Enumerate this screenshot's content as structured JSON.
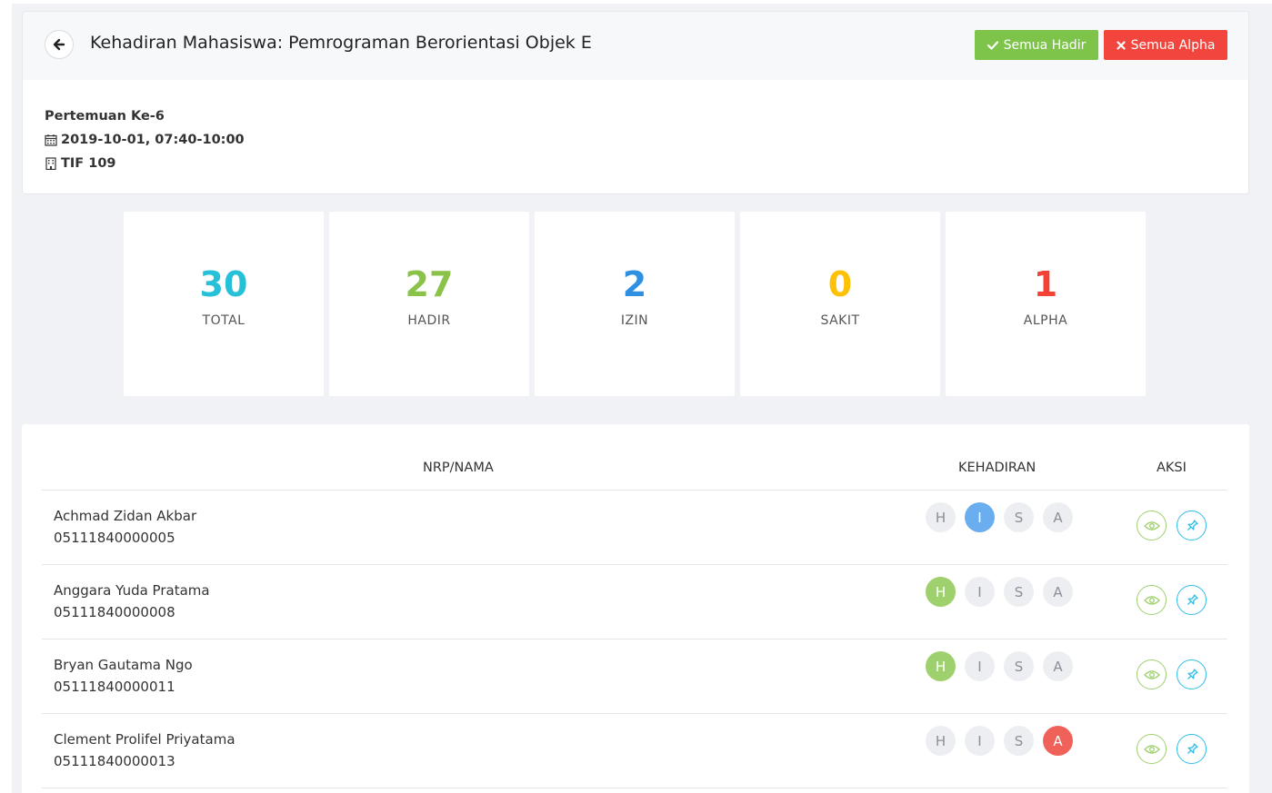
{
  "header": {
    "title": "Kehadiran Mahasiswa: Pemrograman Berorientasi Objek E",
    "btn_all_present": "Semua Hadir",
    "btn_all_absent": "Semua Alpha"
  },
  "meeting": {
    "label": "Pertemuan Ke-6",
    "datetime": "2019-10-01, 07:40-10:00",
    "room": "TIF 109"
  },
  "stats": [
    {
      "value": "30",
      "label": "TOTAL",
      "color": "#26c0d9"
    },
    {
      "value": "27",
      "label": "HADIR",
      "color": "#8bc34a"
    },
    {
      "value": "2",
      "label": "IZIN",
      "color": "#2f8fe0"
    },
    {
      "value": "0",
      "label": "SAKIT",
      "color": "#ffc107"
    },
    {
      "value": "1",
      "label": "ALPHA",
      "color": "#f44336"
    }
  ],
  "table": {
    "headers": {
      "name": "NRP/NAMA",
      "attendance": "KEHADIRAN",
      "action": "AKSI"
    },
    "attendance_options": [
      "H",
      "I",
      "S",
      "A"
    ],
    "rows": [
      {
        "name": "Achmad Zidan Akbar",
        "nrp": "05111840000005",
        "status": "I"
      },
      {
        "name": "Anggara Yuda Pratama",
        "nrp": "05111840000008",
        "status": "H"
      },
      {
        "name": "Bryan Gautama Ngo",
        "nrp": "05111840000011",
        "status": "H"
      },
      {
        "name": "Clement Prolifel Priyatama",
        "nrp": "05111840000013",
        "status": "A"
      }
    ]
  },
  "icons": {
    "back": "arrow-left-icon",
    "check": "check-icon",
    "cross": "cross-icon",
    "calendar": "calendar-icon",
    "building": "building-icon",
    "view": "eye-icon",
    "pin": "pin-icon"
  }
}
